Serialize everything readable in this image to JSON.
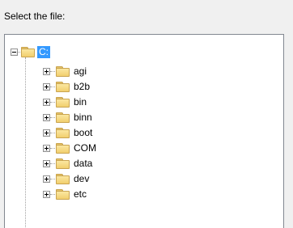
{
  "prompt_label": "Select the file:",
  "tree": {
    "root": {
      "label": "C:",
      "expanded": true,
      "selected": true,
      "icon": "folder-icon"
    },
    "children": [
      {
        "label": "agi",
        "icon": "folder-icon",
        "expanded": false
      },
      {
        "label": "b2b",
        "icon": "folder-icon",
        "expanded": false
      },
      {
        "label": "bin",
        "icon": "folder-icon",
        "expanded": false
      },
      {
        "label": "binn",
        "icon": "folder-icon",
        "expanded": false
      },
      {
        "label": "boot",
        "icon": "folder-icon",
        "expanded": false
      },
      {
        "label": "COM",
        "icon": "folder-icon",
        "expanded": false
      },
      {
        "label": "data",
        "icon": "folder-icon",
        "expanded": false
      },
      {
        "label": "dev",
        "icon": "folder-icon",
        "expanded": false
      },
      {
        "label": "etc",
        "icon": "folder-icon",
        "expanded": false
      }
    ]
  },
  "colors": {
    "selection": "#3399ff",
    "folder": "#f2cf6e",
    "window_bg": "#f0f0f0",
    "tree_bg": "#ffffff"
  }
}
